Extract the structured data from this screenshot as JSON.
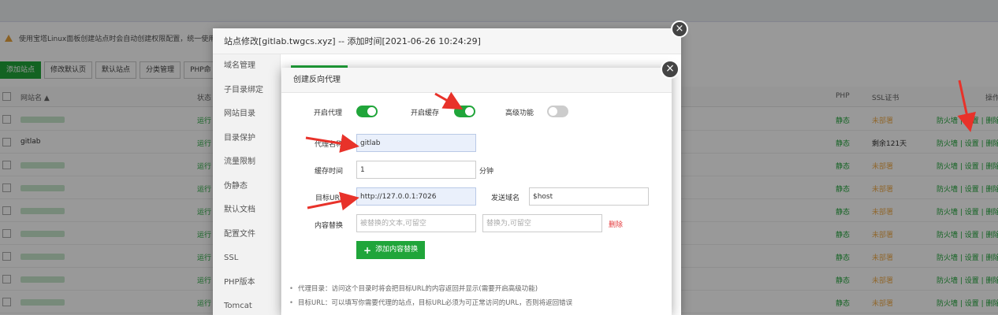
{
  "background": {
    "notice": "使用宝塔Linux面板创建站点时会自动创建权限配置，统一使用",
    "toolbar": [
      "添加站点",
      "修改默认页",
      "默认站点",
      "分类管理",
      "PHP命"
    ],
    "columns": {
      "name": "网站名 ▲",
      "status": "状态",
      "php": "PHP",
      "ssl": "SSL证书",
      "ops": "操作"
    },
    "rows": [
      {
        "name": "",
        "status": "运行",
        "php": "静态",
        "ssl": "未部署",
        "ops": "防火墙 | 设置 | 删除"
      },
      {
        "name": "gitlab",
        "status": "运行",
        "php": "静态",
        "ssl": "剩余121天",
        "ops": "防火墙 | 设置 | 删除"
      },
      {
        "name": "",
        "status": "运行",
        "php": "静态",
        "ssl": "未部署",
        "ops": "防火墙 | 设置 | 删除"
      },
      {
        "name": "",
        "status": "运行",
        "php": "静态",
        "ssl": "未部署",
        "ops": "防火墙 | 设置 | 删除"
      },
      {
        "name": "",
        "status": "运行",
        "php": "静态",
        "ssl": "未部署",
        "ops": "防火墙 | 设置 | 删除"
      },
      {
        "name": "",
        "status": "运行",
        "php": "静态",
        "ssl": "未部署",
        "ops": "防火墙 | 设置 | 删除"
      },
      {
        "name": "",
        "status": "运行",
        "php": "静态",
        "ssl": "未部署",
        "ops": "防火墙 | 设置 | 删除"
      },
      {
        "name": "",
        "status": "运行",
        "php": "静态",
        "ssl": "未部署",
        "ops": "防火墙 | 设置 | 删除"
      },
      {
        "name": "",
        "status": "运行",
        "php": "静态",
        "ssl": "未部署",
        "ops": "防火墙 | 设置 | 删除"
      }
    ]
  },
  "site_dialog": {
    "title": "站点修改[gitlab.twgcs.xyz] -- 添加时间[2021-06-26 10:24:29]",
    "nav": [
      "域名管理",
      "子目录绑定",
      "网站目录",
      "目录保护",
      "流量限制",
      "伪静态",
      "默认文档",
      "配置文件",
      "SSL",
      "PHP版本",
      "Tomcat"
    ],
    "close_icon": "×"
  },
  "proxy_dialog": {
    "title": "创建反向代理",
    "close_icon": "×",
    "enable_proxy_label": "开启代理",
    "enable_proxy": true,
    "enable_cache_label": "开启缓存",
    "enable_cache": true,
    "advanced_label": "高级功能",
    "advanced": false,
    "proxy_name_label": "代理名称",
    "proxy_name_value": "gitlab",
    "cache_time_label": "缓存时间",
    "cache_time_value": "1",
    "cache_time_unit": "分钟",
    "target_url_label": "目标URL",
    "target_url_value": "http://127.0.0.1:7026",
    "send_domain_label": "发送域名",
    "send_domain_value": "$host",
    "content_replace_label": "内容替换",
    "replace_from_placeholder": "被替换的文本,可留空",
    "replace_to_placeholder": "替换为,可留空",
    "delete_label": "删除",
    "add_replace_button": "添加内容替换",
    "notes": [
      "代理目录：访问这个目录时将会把目标URL的内容返回并显示(需要开启高级功能)",
      "目标URL：可以填写你需要代理的站点，目标URL必须为可正常访问的URL，否则将返回错误"
    ]
  },
  "colors": {
    "accent": "#20a53a",
    "warning": "#f0ad4e",
    "danger": "#e4393c",
    "annotation_arrow": "#e8322a"
  }
}
